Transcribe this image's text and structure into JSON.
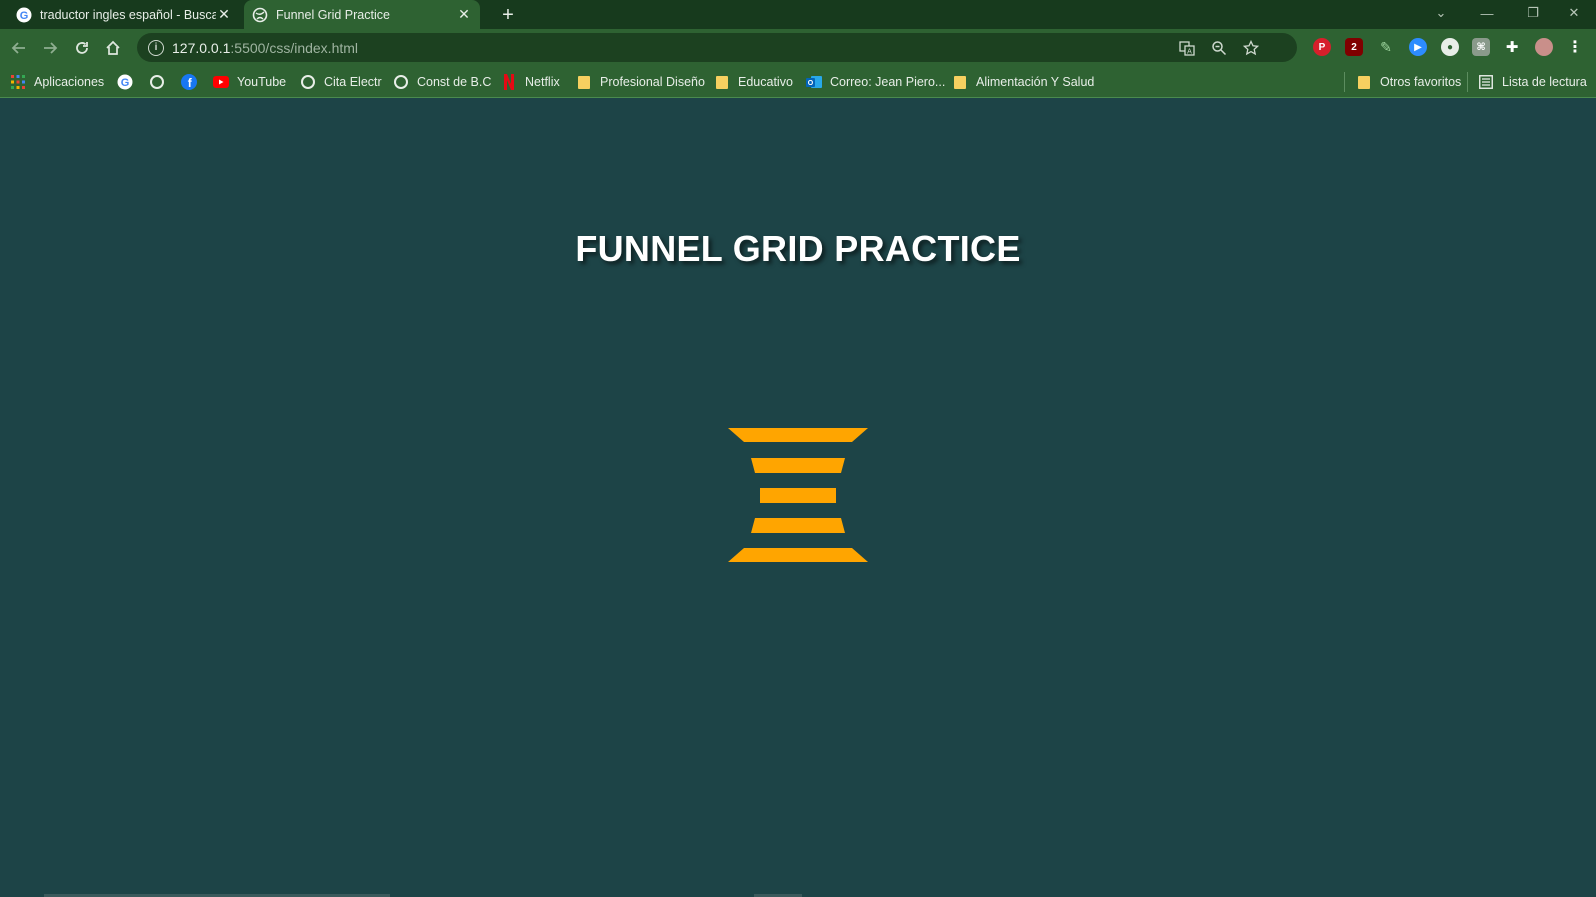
{
  "tabs": [
    {
      "title": "traductor ingles español - Buscar",
      "favicon": "google-icon"
    },
    {
      "title": "Funnel Grid Practice",
      "favicon": "globe-icon"
    }
  ],
  "toolbar": {
    "url_host": "127.0.0.1",
    "url_path": ":5500/css/index.html"
  },
  "bookmarks": [
    {
      "label": "Aplicaciones",
      "icon": "apps-grid-icon"
    },
    {
      "label": "",
      "icon": "google-icon"
    },
    {
      "label": "",
      "icon": "globe-icon"
    },
    {
      "label": "",
      "icon": "facebook-icon"
    },
    {
      "label": "YouTube",
      "icon": "youtube-icon"
    },
    {
      "label": "Cita Electr",
      "icon": "globe-icon"
    },
    {
      "label": "Const de B.C",
      "icon": "globe-icon"
    },
    {
      "label": "Netflix",
      "icon": "netflix-icon"
    },
    {
      "label": "Profesional Diseño",
      "icon": "folder-icon"
    },
    {
      "label": "Educativo",
      "icon": "folder-icon"
    },
    {
      "label": "Correo: Jean Piero...",
      "icon": "outlook-icon"
    },
    {
      "label": "Alimentación Y Salud",
      "icon": "folder-icon"
    }
  ],
  "bookmarks_right": [
    {
      "label": "Otros favoritos",
      "icon": "folder-icon"
    },
    {
      "label": "Lista de lectura",
      "icon": "reading-list-icon"
    }
  ],
  "page": {
    "title": "FUNNEL GRID PRACTICE",
    "funnel_color": "#ffa500",
    "background": "#1d4447"
  },
  "extensions": {
    "ublock_badge": "2"
  }
}
